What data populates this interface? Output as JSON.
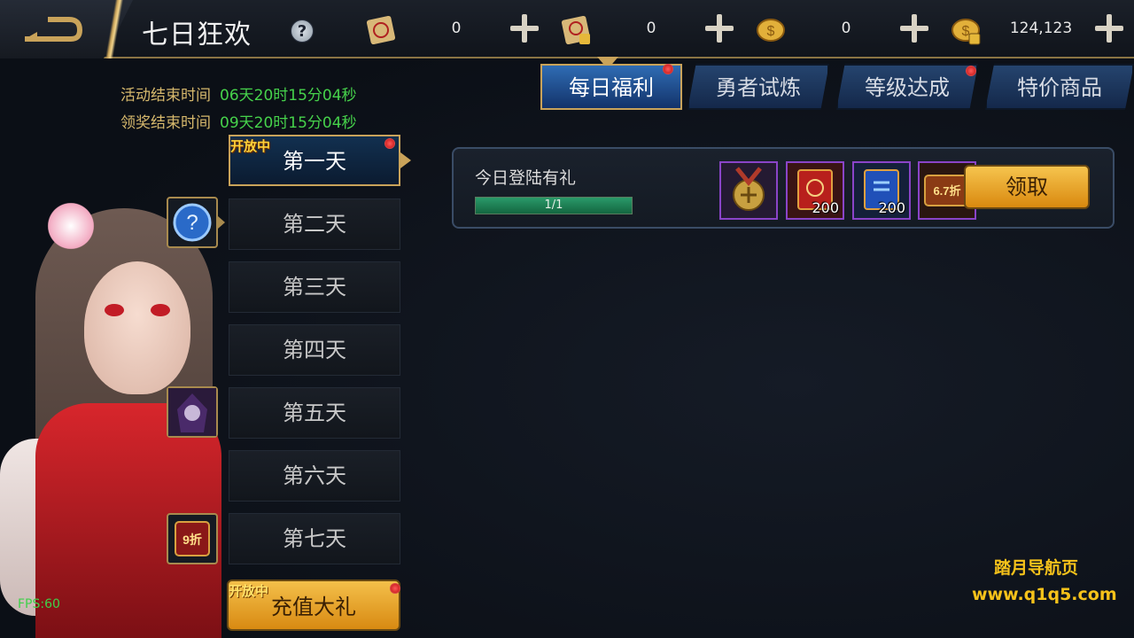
{
  "header": {
    "title": "七日狂欢",
    "resources": [
      {
        "icon": "scroll-icon",
        "value": "0"
      },
      {
        "icon": "locked-scroll-icon",
        "value": "0"
      },
      {
        "icon": "gold-coin-icon",
        "value": "0"
      },
      {
        "icon": "locked-gold-coin-icon",
        "value": "124,123"
      }
    ]
  },
  "timers": {
    "activity_end_label": "活动结束时间",
    "activity_end_value": "06天20时15分04秒",
    "claim_end_label": "领奖结束时间",
    "claim_end_value": "09天20时15分04秒"
  },
  "days": {
    "open_badge": "开放中",
    "items": [
      "第一天",
      "第二天",
      "第三天",
      "第四天",
      "第五天",
      "第六天",
      "第七天"
    ],
    "recharge_label": "充值大礼",
    "recharge_badge": "开放中"
  },
  "tabs": [
    "每日福利",
    "勇者试炼",
    "等级达成",
    "特价商品"
  ],
  "reward": {
    "task_name": "今日登陆有礼",
    "progress_text": "1/1",
    "progress": 1.0,
    "items": [
      {
        "icon": "medal-icon",
        "qty": ""
      },
      {
        "icon": "red-book-icon",
        "qty": "200"
      },
      {
        "icon": "blue-book-icon",
        "qty": "200"
      },
      {
        "icon": "discount-ticket-icon",
        "qty": "",
        "tag": "6.7折"
      }
    ],
    "claim_label": "领取"
  },
  "side_icons": {
    "discount_tag": "9折"
  },
  "debug": {
    "fps": "FPS:60"
  },
  "watermark": {
    "line1": "踏月导航页",
    "line2": "www.q1q5.com"
  },
  "colors": {
    "accent_gold": "#c9a35a",
    "timer_green": "#46d24b",
    "tab_blue": "#25446e"
  }
}
